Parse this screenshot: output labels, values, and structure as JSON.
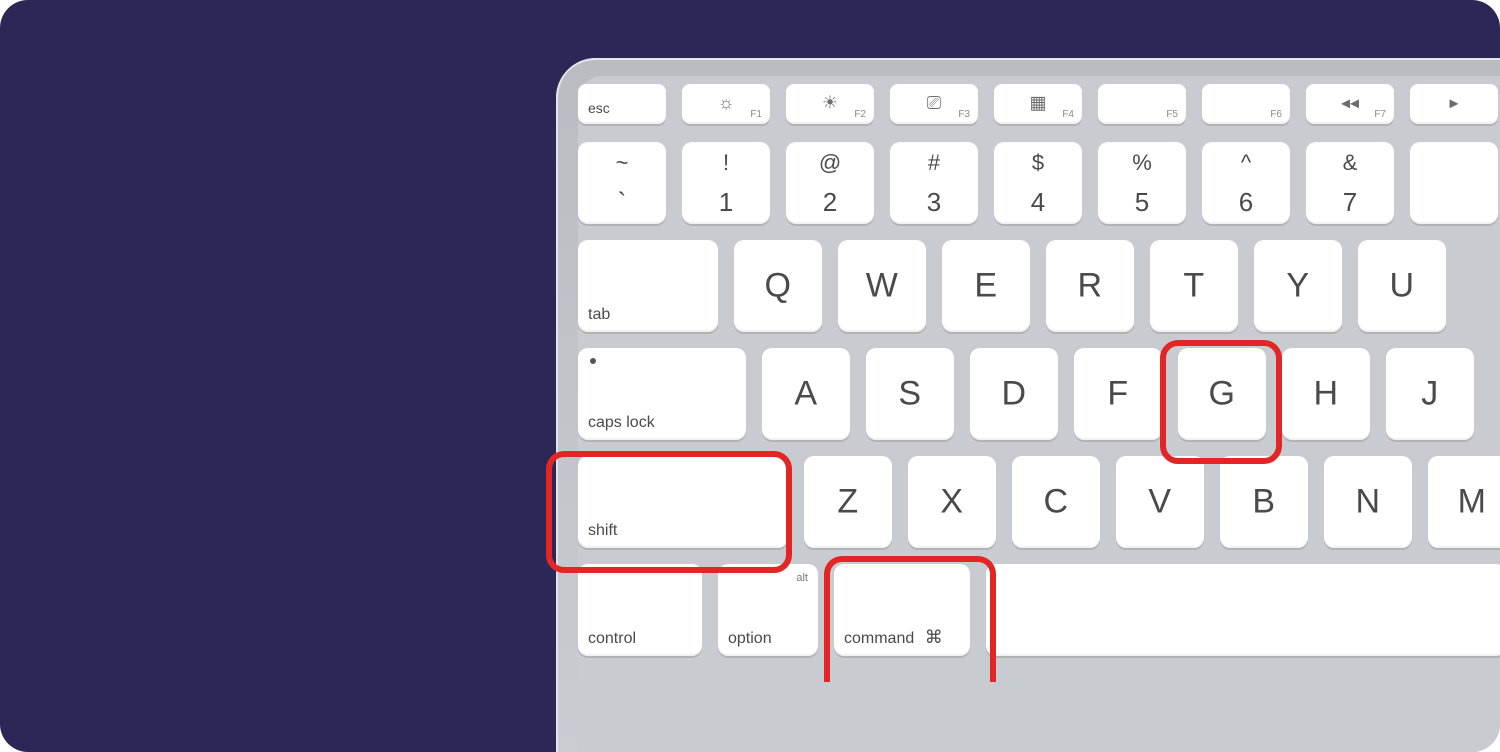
{
  "fnRow": [
    {
      "name": "esc",
      "label": "esc",
      "icon": "",
      "fnum": ""
    },
    {
      "name": "f1",
      "label": "",
      "icon": "☼",
      "fnum": "F1"
    },
    {
      "name": "f2",
      "label": "",
      "icon": "☀",
      "fnum": "F2"
    },
    {
      "name": "f3",
      "label": "",
      "icon": "⎚",
      "fnum": "F3"
    },
    {
      "name": "f4",
      "label": "",
      "icon": "▦",
      "fnum": "F4"
    },
    {
      "name": "f5",
      "label": "",
      "icon": "",
      "fnum": "F5"
    },
    {
      "name": "f6",
      "label": "",
      "icon": "",
      "fnum": "F6"
    },
    {
      "name": "f7",
      "label": "",
      "icon": "◂◂",
      "fnum": "F7"
    },
    {
      "name": "f8",
      "label": "",
      "icon": "▸",
      "fnum": ""
    }
  ],
  "numRow": [
    {
      "name": "tilde",
      "top": "~",
      "bot": "`"
    },
    {
      "name": "1",
      "top": "!",
      "bot": "1"
    },
    {
      "name": "2",
      "top": "@",
      "bot": "2"
    },
    {
      "name": "3",
      "top": "#",
      "bot": "3"
    },
    {
      "name": "4",
      "top": "$",
      "bot": "4"
    },
    {
      "name": "5",
      "top": "%",
      "bot": "5"
    },
    {
      "name": "6",
      "top": "^",
      "bot": "6"
    },
    {
      "name": "7",
      "top": "&",
      "bot": "7"
    },
    {
      "name": "8",
      "top": "",
      "bot": ""
    }
  ],
  "rowQ": {
    "wide": "tab",
    "keys": [
      "Q",
      "W",
      "E",
      "R",
      "T",
      "Y",
      "U"
    ]
  },
  "rowA": {
    "wide": "caps lock",
    "keys": [
      "A",
      "S",
      "D",
      "F",
      "G",
      "H",
      "J"
    ]
  },
  "rowZ": {
    "wide": "shift",
    "keys": [
      "Z",
      "X",
      "C",
      "V",
      "B",
      "N",
      "M"
    ]
  },
  "botRow": {
    "control": "control",
    "alt": "alt",
    "option": "option",
    "command": "command",
    "cmdSym": "⌘"
  },
  "highlights": {
    "shift": true,
    "command": true,
    "g": true
  }
}
